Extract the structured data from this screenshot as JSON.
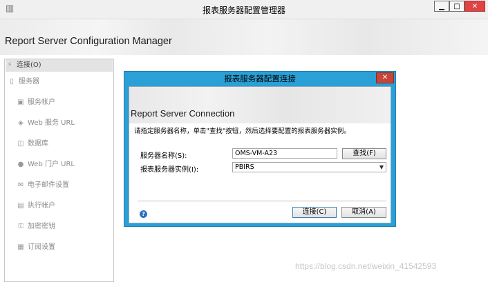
{
  "window": {
    "title": "报表服务器配置管理器",
    "header_title": "Report Server Configuration Manager",
    "buttons": {
      "minimize": "▁",
      "maximize": "□",
      "close": "✕"
    }
  },
  "sidebar": {
    "items": [
      {
        "label": "连接(O)",
        "icon": "plug-icon",
        "glyph": "⚡"
      },
      {
        "label": "服务器",
        "icon": "server-icon",
        "glyph": "▯"
      },
      {
        "label": "服务帐户",
        "icon": "account-icon",
        "glyph": "▣"
      },
      {
        "label": "Web 服务 URL",
        "icon": "web-service-icon",
        "glyph": "◈"
      },
      {
        "label": "数据库",
        "icon": "database-icon",
        "glyph": "◫"
      },
      {
        "label": "Web 门户 URL",
        "icon": "web-portal-icon",
        "glyph": "●"
      },
      {
        "label": "电子邮件设置",
        "icon": "email-icon",
        "glyph": "✉"
      },
      {
        "label": "执行帐户",
        "icon": "execution-account-icon",
        "glyph": "▤"
      },
      {
        "label": "加密密钥",
        "icon": "key-icon",
        "glyph": "⚿"
      },
      {
        "label": "订阅设置",
        "icon": "subscription-icon",
        "glyph": "▦"
      }
    ]
  },
  "dialog": {
    "title": "报表服务器配置连接",
    "close": "✕",
    "header_title": "Report Server Connection",
    "instruction": "请指定服务器名称，单击\"查找\"按钮，然后选择要配置的报表服务器实例。",
    "server_label": "服务器名称(S):",
    "server_value": "OMS-VM-A23",
    "find_button": "查找(F)",
    "instance_label": "报表服务器实例(I):",
    "instance_value": "PBIRS",
    "connect_button": "连接(C)",
    "cancel_button": "取消(A)",
    "help": "?"
  },
  "watermark": "https://blog.csdn.net/weixin_41542593"
}
